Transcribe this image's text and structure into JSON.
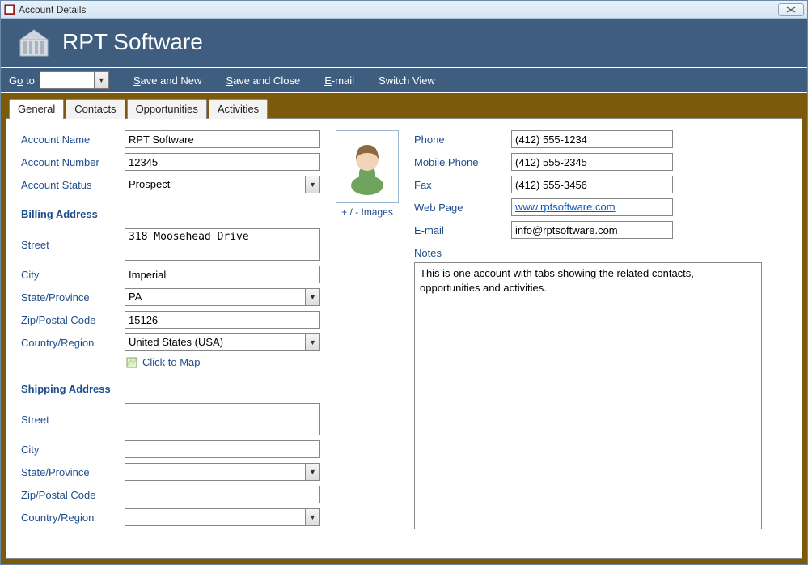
{
  "window": {
    "title": "Account Details"
  },
  "brand": {
    "title": "RPT Software"
  },
  "toolbar": {
    "goto_label_pre": "G",
    "goto_label_u": "o",
    "goto_label_post": " to",
    "save_new_pre": "",
    "save_new_u": "S",
    "save_new_post": "ave and New",
    "save_close_u": "S",
    "save_close_post": "ave and Close",
    "email_u": "E",
    "email_post": "-mail",
    "switch_view": "Switch View"
  },
  "tabs": [
    "General",
    "Contacts",
    "Opportunities",
    "Activities"
  ],
  "labels": {
    "account_name": "Account Name",
    "account_number": "Account Number",
    "account_status": "Account Status",
    "billing_address": "Billing Address",
    "street": "Street",
    "city": "City",
    "state": "State/Province",
    "zip": "Zip/Postal Code",
    "country": "Country/Region",
    "click_to_map": "Click to Map",
    "shipping_address": "Shipping Address",
    "images_toggle": "+ / -  Images",
    "phone": "Phone",
    "mobile": "Mobile Phone",
    "fax": "Fax",
    "webpage": "Web Page",
    "email": "E-mail",
    "notes": "Notes"
  },
  "values": {
    "account_name": "RPT Software",
    "account_number": "12345",
    "account_status": "Prospect",
    "billing": {
      "street": "318 Moosehead Drive",
      "city": "Imperial",
      "state": "PA",
      "zip": "15126",
      "country": "United States (USA)"
    },
    "shipping": {
      "street": "",
      "city": "",
      "state": "",
      "zip": "",
      "country": ""
    },
    "phone": "(412) 555-1234",
    "mobile": "(412) 555-2345",
    "fax": "(412) 555-3456",
    "webpage": "www.rptsoftware.com",
    "email": "info@rptsoftware.com",
    "notes": "This is one account with tabs showing the related contacts, opportunities and activities."
  }
}
